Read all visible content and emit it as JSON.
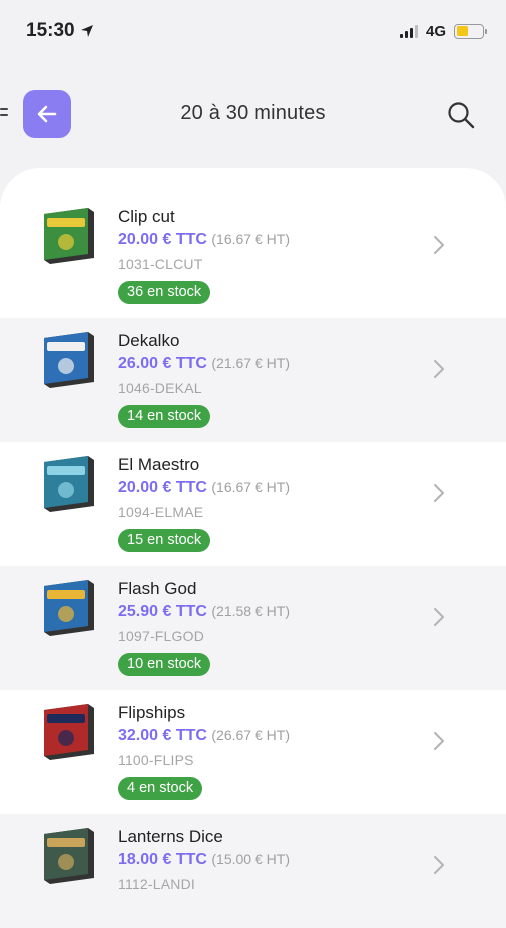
{
  "status_bar": {
    "time": "15:30",
    "network": "4G",
    "battery_color": "#f5c518"
  },
  "header": {
    "title": "20 à 30 minutes",
    "accent": "#8a7cf1",
    "back_icon": "arrow-left-icon",
    "search_icon": "search-icon"
  },
  "products": [
    {
      "name": "Clip cut",
      "price_ttc": "20.00 € TTC",
      "price_ht": "(16.67 € HT)",
      "sku": "1031-CLCUT",
      "stock": "36 en stock",
      "box_color": "#3b8f3e",
      "box_accent": "#e7c93a"
    },
    {
      "name": "Dekalko",
      "price_ttc": "26.00 € TTC",
      "price_ht": "(21.67 € HT)",
      "sku": "1046-DEKAL",
      "stock": "14 en stock",
      "box_color": "#2e6fb6",
      "box_accent": "#f0f0f0"
    },
    {
      "name": "El Maestro",
      "price_ttc": "20.00 € TTC",
      "price_ht": "(16.67 € HT)",
      "sku": "1094-ELMAE",
      "stock": "15 en stock",
      "box_color": "#2d7f9c",
      "box_accent": "#8ed2e6"
    },
    {
      "name": "Flash God",
      "price_ttc": "25.90 € TTC",
      "price_ht": "(21.58 € HT)",
      "sku": "1097-FLGOD",
      "stock": "10 en stock",
      "box_color": "#2c6fb0",
      "box_accent": "#e9b536"
    },
    {
      "name": "Flipships",
      "price_ttc": "32.00 € TTC",
      "price_ht": "(26.67 € HT)",
      "sku": "1100-FLIPS",
      "stock": "4 en stock",
      "box_color": "#b02a2a",
      "box_accent": "#1e2a5a"
    },
    {
      "name": "Lanterns Dice",
      "price_ttc": "18.00 € TTC",
      "price_ht": "(15.00 € HT)",
      "sku": "1112-LANDI",
      "stock": "",
      "box_color": "#3f5a4a",
      "box_accent": "#c9a45a"
    }
  ],
  "colors": {
    "price": "#7b6cf0",
    "stock_badge": "#3fa244"
  }
}
